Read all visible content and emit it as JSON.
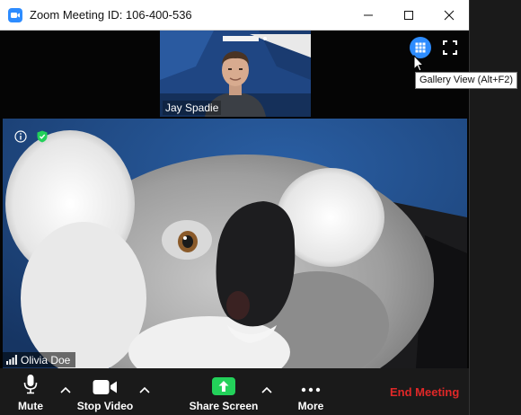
{
  "window": {
    "title": "Zoom Meeting ID: 106-400-536",
    "controls": [
      "minimize-icon",
      "maximize-icon",
      "close-icon"
    ]
  },
  "self_view": {
    "name": "Jay Spadie"
  },
  "view_controls": {
    "gallery_icon": "grid-icon",
    "fullscreen_icon": "fullscreen-icon",
    "tooltip": "Gallery View (Alt+F2)"
  },
  "active_speaker": {
    "name": "Olivia Doe",
    "icons": [
      "info-icon",
      "shield-icon",
      "signal-icon"
    ]
  },
  "toolbar": {
    "mute_label": "Mute",
    "stop_video_label": "Stop Video",
    "share_screen_label": "Share Screen",
    "more_label": "More",
    "end_meeting_label": "End Meeting"
  },
  "colors": {
    "accent": "#2d8cff",
    "share_green": "#23d15a",
    "end_red": "#e02828",
    "toolbar_bg": "#1a1a1a",
    "window_bg": "#050505"
  }
}
